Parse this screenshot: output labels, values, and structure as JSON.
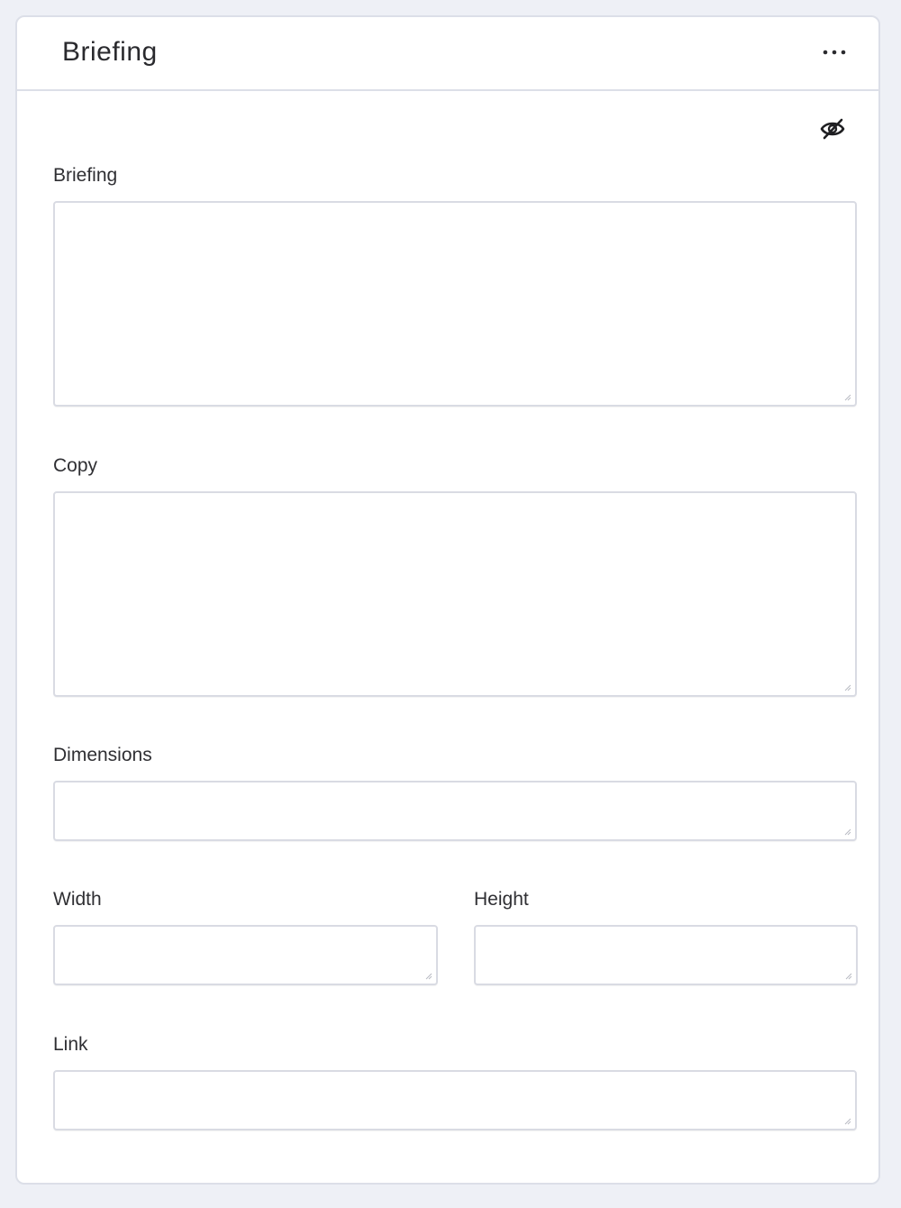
{
  "card": {
    "title": "Briefing",
    "more_icon": "ellipsis-horizontal-icon",
    "visibility_icon": "eye-slash-icon"
  },
  "fields": {
    "briefing": {
      "label": "Briefing",
      "value": ""
    },
    "copy": {
      "label": "Copy",
      "value": ""
    },
    "dimensions": {
      "label": "Dimensions",
      "value": ""
    },
    "width": {
      "label": "Width",
      "value": ""
    },
    "height": {
      "label": "Height",
      "value": ""
    },
    "link": {
      "label": "Link",
      "value": ""
    }
  },
  "colors": {
    "page_background": "#eef0f6",
    "card_border": "#dcdfe8",
    "input_border": "#d9dbe3",
    "text": "#2f2f33"
  }
}
